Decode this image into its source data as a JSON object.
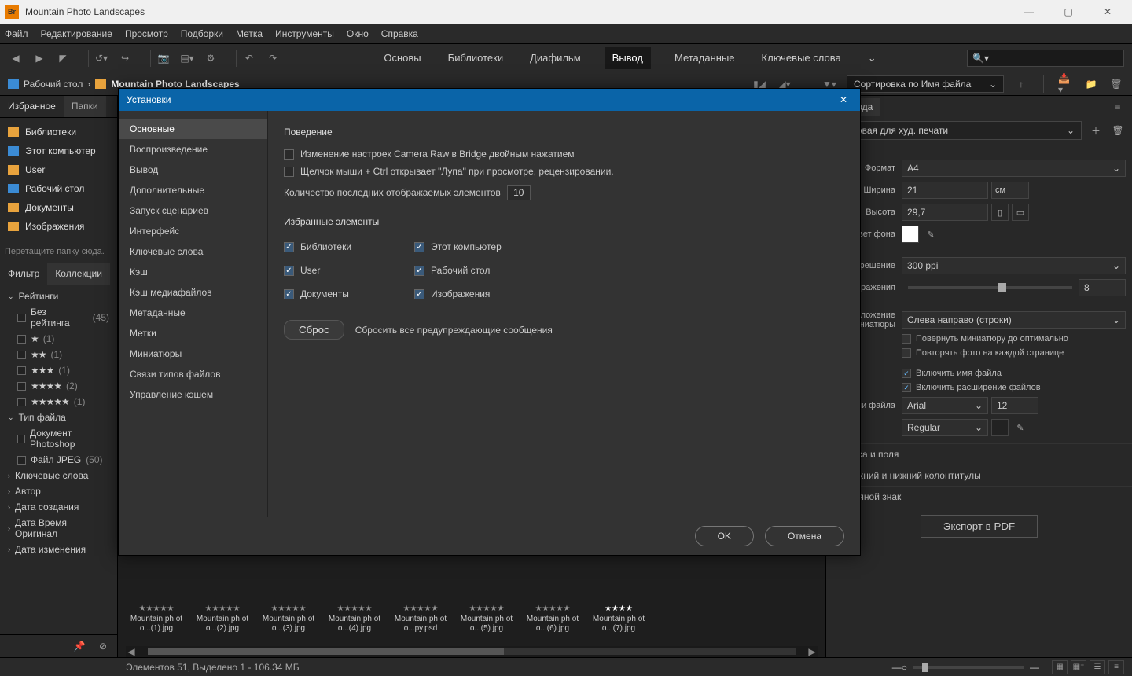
{
  "titlebar": {
    "title": "Mountain Photo Landscapes"
  },
  "menubar": [
    "Файл",
    "Редактирование",
    "Просмотр",
    "Подборки",
    "Метка",
    "Инструменты",
    "Окно",
    "Справка"
  ],
  "workspaces": {
    "items": [
      "Основы",
      "Библиотеки",
      "Диафильм",
      "Вывод",
      "Метаданные",
      "Ключевые слова"
    ],
    "active": "Вывод"
  },
  "pathbar": {
    "seg1": "Рабочий стол",
    "seg2": "Mountain Photo Landscapes",
    "sort_label": "Сортировка по Имя файла"
  },
  "left": {
    "tabs": {
      "fav": "Избранное",
      "folders": "Папки"
    },
    "favorites": [
      {
        "label": "Библиотеки",
        "icon": "yellow"
      },
      {
        "label": "Этот компьютер",
        "icon": "blue"
      },
      {
        "label": "User",
        "icon": "yellow"
      },
      {
        "label": "Рабочий стол",
        "icon": "blue"
      },
      {
        "label": "Документы",
        "icon": "yellow"
      },
      {
        "label": "Изображения",
        "icon": "yellow"
      }
    ],
    "drag_hint": "Перетащите папку сюда.",
    "filter_tabs": {
      "filter": "Фильтр",
      "collections": "Коллекции"
    },
    "filters": {
      "ratings_title": "Рейтинги",
      "ratings": [
        {
          "label": "Без рейтинга",
          "count": "(45)"
        },
        {
          "label": "★",
          "count": "(1)"
        },
        {
          "label": "★★",
          "count": "(1)"
        },
        {
          "label": "★★★",
          "count": "(1)"
        },
        {
          "label": "★★★★",
          "count": "(2)"
        },
        {
          "label": "★★★★★",
          "count": "(1)"
        }
      ],
      "filetype_title": "Тип файла",
      "filetypes": [
        {
          "label": "Документ Photoshop"
        },
        {
          "label": "Файл JPEG",
          "count": "(50)"
        }
      ],
      "more": [
        "Ключевые слова",
        "Автор",
        "Дата создания",
        "Дата Время Оригинал",
        "Дата изменения"
      ]
    }
  },
  "thumbs": [
    {
      "name": "Mountain ph oto...(1).jpg",
      "stars": 0
    },
    {
      "name": "Mountain ph oto...(2).jpg",
      "stars": 0
    },
    {
      "name": "Mountain ph oto...(3).jpg",
      "stars": 0
    },
    {
      "name": "Mountain ph oto...(4).jpg",
      "stars": 0
    },
    {
      "name": "Mountain ph oto...py.psd",
      "stars": 0
    },
    {
      "name": "Mountain ph oto...(5).jpg",
      "stars": 0
    },
    {
      "name": "Mountain ph oto...(6).jpg",
      "stars": 0
    },
    {
      "name": "Mountain ph oto...(7).jpg",
      "stars": 4
    }
  ],
  "right": {
    "tab_label": "вывода",
    "preset": "Матовая для худ. печати",
    "format_label": "Формат",
    "format_value": "A4",
    "width_label": "Ширина",
    "width_value": "21",
    "width_unit": "см",
    "height_label": "Высота",
    "height_value": "29,7",
    "bg_label": "Цвет фона",
    "res_label": "Разрешение",
    "res_value": "300 ppi",
    "imgsize_label": "о изображения",
    "imgsize_value": "8",
    "thumb_layout_label": "Расположение миниатюры",
    "thumb_layout_value": "Слева направо (строки)",
    "rotate_cb": "Повернуть миниатюру до оптимально",
    "repeat_cb": "Повторять фото на каждой странице",
    "inc_name_cb": "Включить имя файла",
    "inc_ext_cb": "Включить расширение файлов",
    "fname_label": "т имени файла",
    "font_value": "Arial",
    "fontsize_value": "12",
    "fontstyle_value": "Regular",
    "collapse": [
      "Сетка и поля",
      "Верхний и нижний колонтитулы",
      "Водяной знак"
    ],
    "export_btn": "Экспорт в PDF"
  },
  "statusbar": {
    "text": "Элементов 51, Выделено 1 - 106.34 МБ"
  },
  "dialog": {
    "title": "Установки",
    "nav": [
      "Основные",
      "Воспроизведение",
      "Вывод",
      "Дополнительные",
      "Запуск сценариев",
      "Интерфейс",
      "Ключевые слова",
      "Кэш",
      "Кэш медиафайлов",
      "Метаданные",
      "Метки",
      "Миниатюры",
      "Связи типов файлов",
      "Управление кэшем"
    ],
    "nav_active": "Основные",
    "behavior_title": "Поведение",
    "cr_cb": "Изменение настроек Camera Raw в Bridge двойным нажатием",
    "loupe_cb": "Щелчок мыши + Ctrl открывает \"Лупа\" при просмотре, рецензировании.",
    "recent_label": "Количество последних отображаемых элементов",
    "recent_value": "10",
    "fav_title": "Избранные элементы",
    "fav_left": [
      "Библиотеки",
      "User",
      "Документы"
    ],
    "fav_right": [
      "Этот компьютер",
      "Рабочий стол",
      "Изображения"
    ],
    "reset_btn": "Сброс",
    "reset_text": "Сбросить все предупреждающие сообщения",
    "ok": "OK",
    "cancel": "Отмена"
  }
}
